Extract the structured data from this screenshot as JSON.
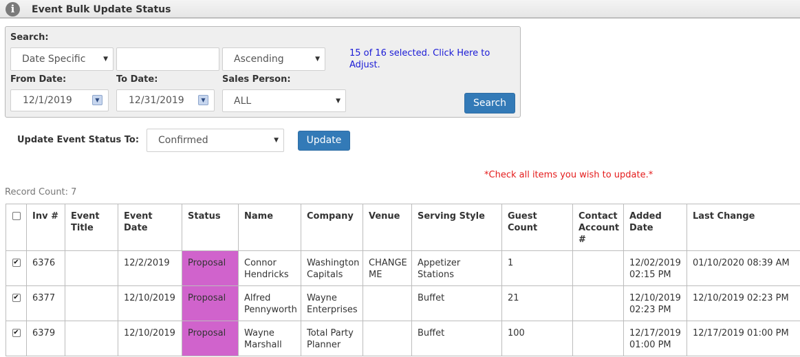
{
  "header": {
    "title": "Event Bulk Update Status",
    "icon": "info-icon"
  },
  "search": {
    "label": "Search:",
    "type_value": "Date Specific",
    "text_value": "",
    "order_value": "Ascending",
    "selected_link": "15 of 16 selected. Click Here to Adjust.",
    "from_label": "From Date:",
    "from_value": "12/1/2019",
    "to_label": "To Date:",
    "to_value": "12/31/2019",
    "sales_label": "Sales Person:",
    "sales_value": "ALL",
    "button": "Search"
  },
  "update": {
    "label": "Update Event Status To:",
    "status_value": "Confirmed",
    "button": "Update"
  },
  "warning": "*Check all items you wish to update.*",
  "record_count": "Record Count: 7",
  "table": {
    "columns": [
      "Inv #",
      "Event Title",
      "Event Date",
      "Status",
      "Name",
      "Company",
      "Venue",
      "Serving Style",
      "Guest Count",
      "Contact Account #",
      "Added Date",
      "Last Change"
    ],
    "rows": [
      {
        "checked": true,
        "inv": "6376",
        "event_title": "",
        "event_date": "12/2/2019",
        "status": "Proposal",
        "name": "Connor Hendricks",
        "company": "Washington Capitals",
        "venue": "CHANGE ME",
        "serving_style": "Appetizer Stations",
        "guest_count": "1",
        "contact_account": "",
        "added_date": "12/02/2019 02:15 PM",
        "last_change": "01/10/2020 08:39 AM"
      },
      {
        "checked": true,
        "inv": "6377",
        "event_title": "",
        "event_date": "12/10/2019",
        "status": "Proposal",
        "name": "Alfred Pennyworth",
        "company": "Wayne Enterprises",
        "venue": "",
        "serving_style": "Buffet",
        "guest_count": "21",
        "contact_account": "",
        "added_date": "12/10/2019 02:23 PM",
        "last_change": "12/10/2019 02:23 PM"
      },
      {
        "checked": true,
        "inv": "6379",
        "event_title": "",
        "event_date": "12/10/2019",
        "status": "Proposal",
        "name": "Wayne Marshall",
        "company": "Total Party Planner",
        "venue": "",
        "serving_style": "Buffet",
        "guest_count": "100",
        "contact_account": "",
        "added_date": "12/17/2019 01:00 PM",
        "last_change": "12/17/2019 01:00 PM"
      }
    ]
  },
  "colors": {
    "status_proposal": "#d063cc",
    "link": "#1a1ad6",
    "button": "#337ab7",
    "warning": "#e41b1b"
  }
}
